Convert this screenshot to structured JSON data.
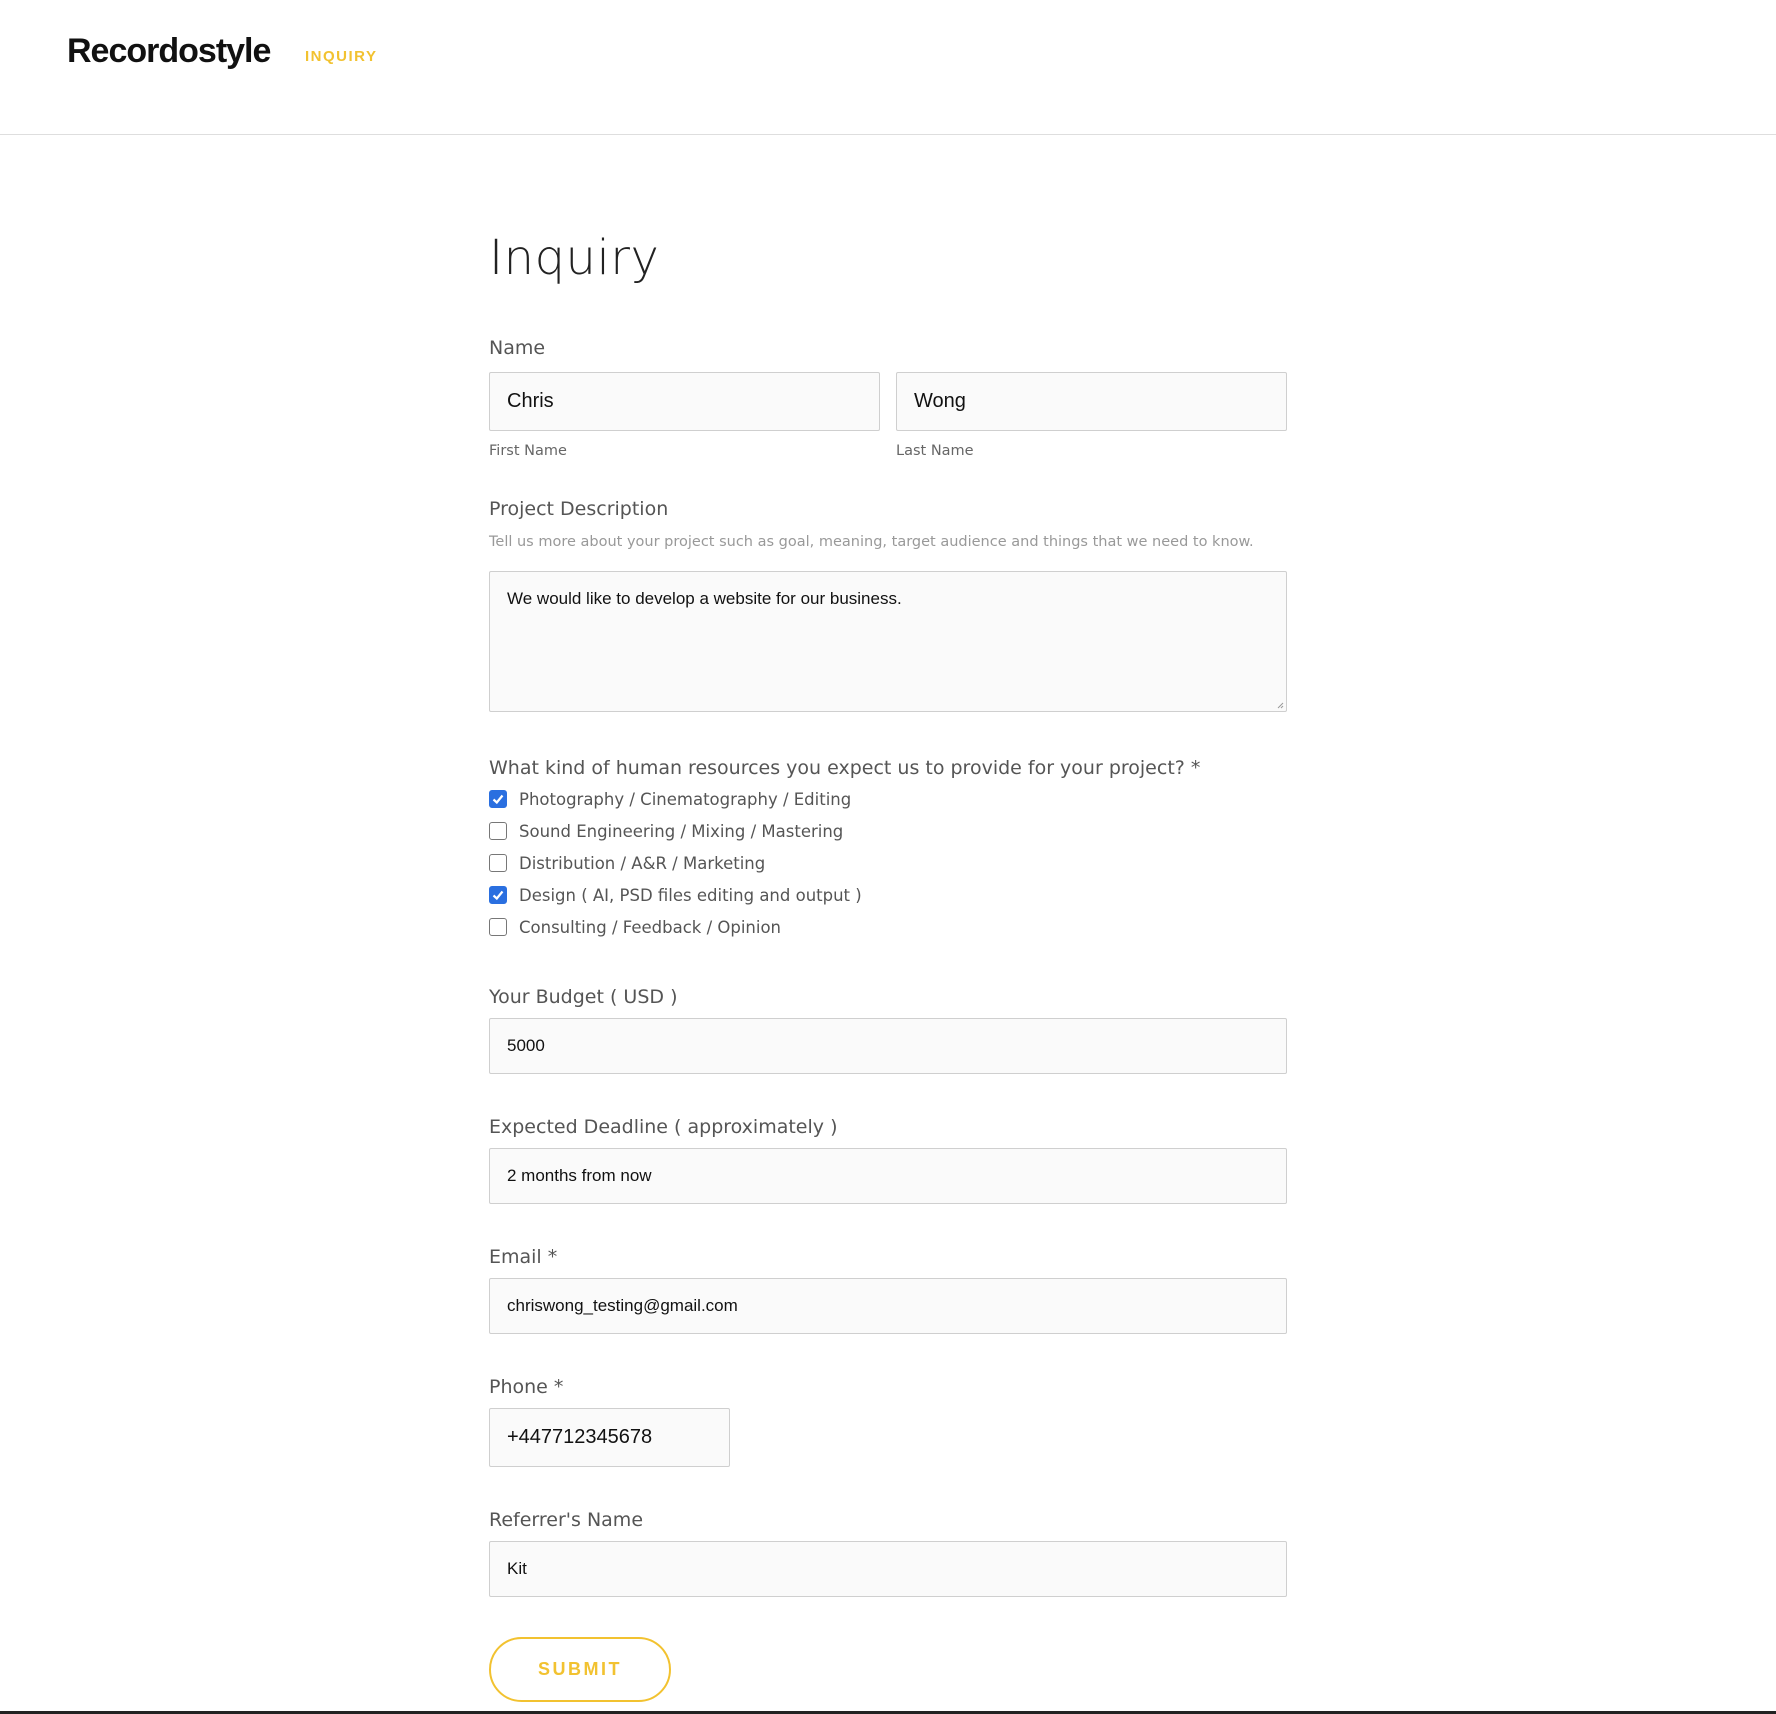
{
  "header": {
    "brand": "Recordostyle",
    "nav": "INQUIRY"
  },
  "form": {
    "title": "Inquiry",
    "name": {
      "label": "Name",
      "first_value": "Chris",
      "first_sublabel": "First Name",
      "last_value": "Wong",
      "last_sublabel": "Last Name"
    },
    "project": {
      "label": "Project Description",
      "description": "Tell us more about your project such as goal, meaning, target audience and things that we need to know.",
      "value": "We would like to develop a website for our business."
    },
    "resources": {
      "label": "What kind of human resources you expect us to provide for your project? *",
      "options": [
        {
          "label": "Photography / Cinematography / Editing",
          "checked": true
        },
        {
          "label": "Sound Engineering / Mixing / Mastering",
          "checked": false
        },
        {
          "label": "Distribution / A&R / Marketing",
          "checked": false
        },
        {
          "label": "Design ( AI, PSD files editing and output )",
          "checked": true
        },
        {
          "label": "Consulting / Feedback / Opinion",
          "checked": false
        }
      ]
    },
    "budget": {
      "label": "Your Budget ( USD )",
      "value": "5000"
    },
    "deadline": {
      "label": "Expected Deadline ( approximately )",
      "value": "2 months from now"
    },
    "email": {
      "label": "Email *",
      "value": "chriswong_testing@gmail.com"
    },
    "phone": {
      "label": "Phone *",
      "value": "+447712345678"
    },
    "referrer": {
      "label": "Referrer's Name",
      "value": "Kit"
    },
    "submit": "SUBMIT"
  },
  "colors": {
    "accent": "#f2c230",
    "checkbox": "#2a6fe0"
  }
}
